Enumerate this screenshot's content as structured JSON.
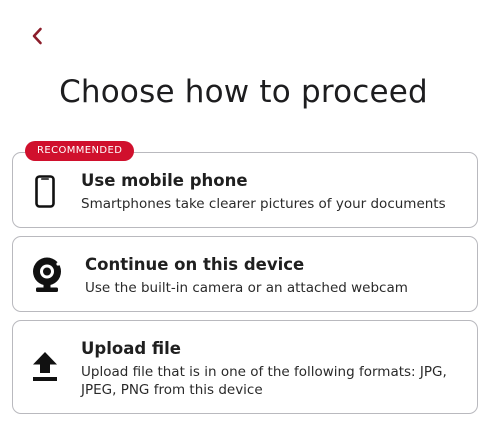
{
  "header": {
    "back_icon": "chevron-left-icon",
    "title": "Choose how to proceed"
  },
  "options": [
    {
      "badge": "RECOMMENDED",
      "icon": "mobile-phone-icon",
      "title": "Use mobile phone",
      "description": "Smartphones take clearer pictures of your documents"
    },
    {
      "icon": "webcam-icon",
      "title": "Continue on this device",
      "description": "Use the built-in camera or an attached webcam"
    },
    {
      "icon": "upload-icon",
      "title": "Upload file",
      "description": "Upload file that is in one of the following formats: JPG, JPEG, PNG from this device"
    }
  ],
  "colors": {
    "accent": "#d0102d",
    "back_chevron": "#8c1d2a",
    "card_border": "#b9b9be",
    "text": "#1f1f1f"
  }
}
